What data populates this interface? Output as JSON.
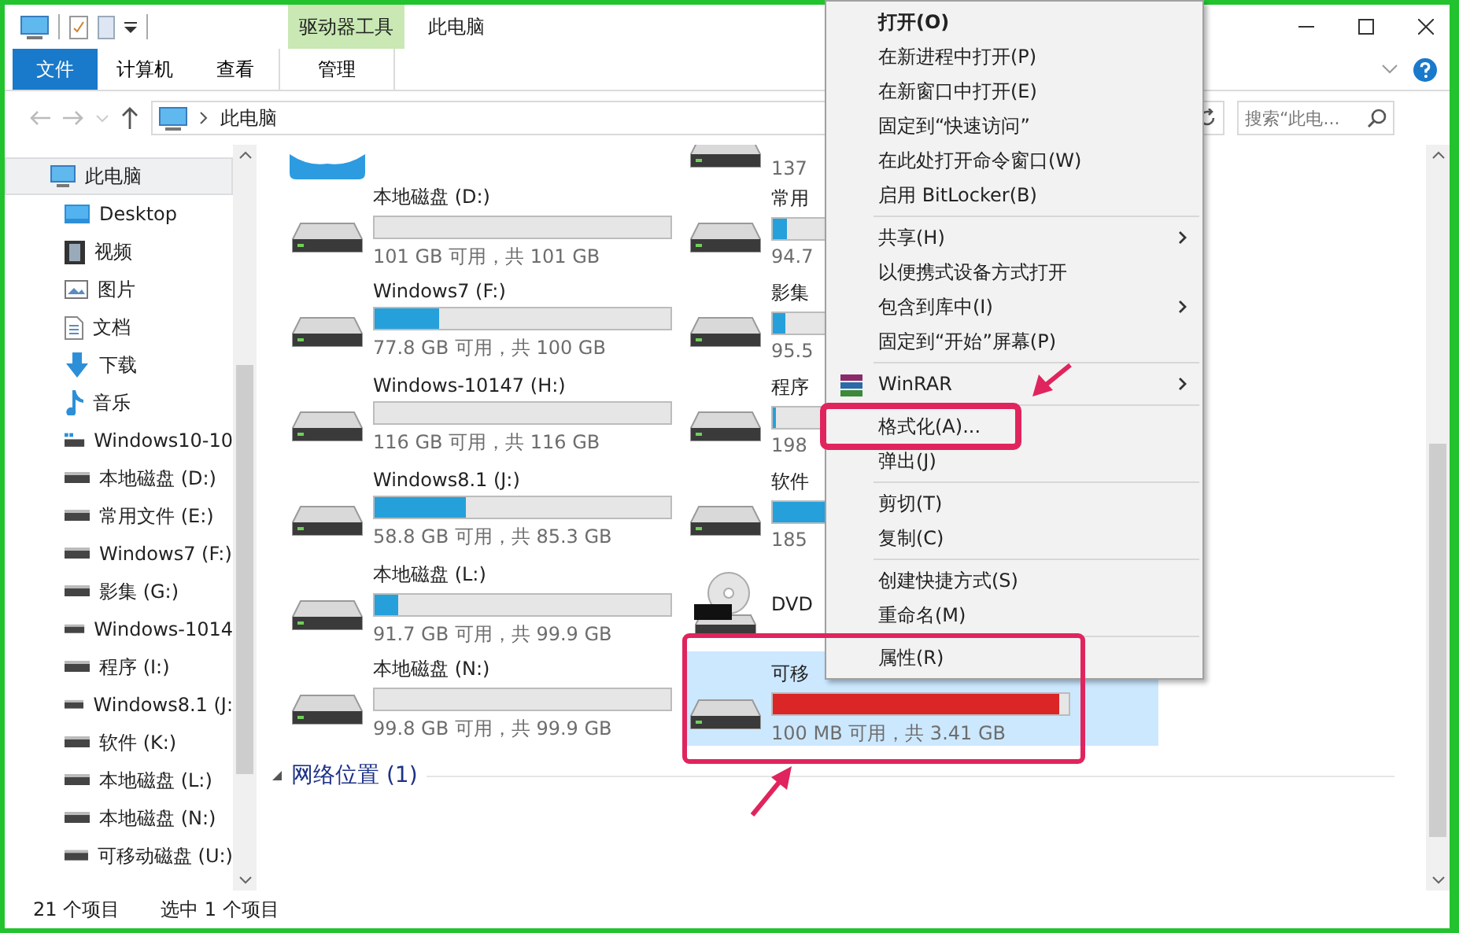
{
  "window": {
    "title": "此电脑",
    "context_group": "驱动器工具"
  },
  "ribbon_tabs": [
    {
      "label": "文件",
      "kind": "file"
    },
    {
      "label": "计算机",
      "kind": "tab"
    },
    {
      "label": "查看",
      "kind": "tab"
    },
    {
      "label": "管理",
      "kind": "context"
    }
  ],
  "address": {
    "path": "此电脑"
  },
  "search": {
    "placeholder": "搜索“此电..."
  },
  "sidebar": {
    "items": [
      {
        "label": "此电脑",
        "selected": true,
        "children": [
          {
            "label": "Desktop",
            "selected": false
          },
          {
            "label": "视频",
            "selected": false
          },
          {
            "label": "图片",
            "selected": false
          },
          {
            "label": "文档",
            "selected": false
          },
          {
            "label": "下载",
            "selected": false
          },
          {
            "label": "音乐",
            "selected": false
          },
          {
            "label": "Windows10-10",
            "selected": false
          },
          {
            "label": "本地磁盘 (D:)",
            "selected": false
          },
          {
            "label": "常用文件 (E:)",
            "selected": false
          },
          {
            "label": "Windows7 (F:)",
            "selected": false
          },
          {
            "label": "影集 (G:)",
            "selected": false
          },
          {
            "label": "Windows-1014",
            "selected": false
          },
          {
            "label": "程序 (I:)",
            "selected": false
          },
          {
            "label": "Windows8.1 (J:",
            "selected": false
          },
          {
            "label": "软件 (K:)",
            "selected": false
          },
          {
            "label": "本地磁盘 (L:)",
            "selected": false
          },
          {
            "label": "本地磁盘 (N:)",
            "selected": false
          },
          {
            "label": "可移动磁盘 (U:)",
            "selected": false
          }
        ]
      }
    ]
  },
  "drives": [
    {
      "kind": "app"
    },
    {
      "kind": "cut",
      "free_text": "137"
    },
    {
      "kind": "disk",
      "name": "本地磁盘 (D:)",
      "selected": false,
      "free_text": "101 GB 可用，共 101 GB"
    },
    {
      "kind": "disk",
      "name": "常用",
      "level": 0.05,
      "warning": false,
      "selected": false,
      "free_text": "94.7"
    },
    {
      "kind": "disk",
      "name": "Windows7 (F:)",
      "level": 0.22,
      "warning": false,
      "selected": false,
      "free_text": "77.8 GB 可用，共 100 GB"
    },
    {
      "kind": "disk",
      "name": "影集",
      "level": 0.04,
      "warning": false,
      "selected": false,
      "free_text": "95.5"
    },
    {
      "kind": "disk",
      "name": "Windows-10147 (H:)",
      "selected": false,
      "free_text": "116 GB 可用，共 116 GB"
    },
    {
      "kind": "disk",
      "name": "程序",
      "level": 0.01,
      "warning": false,
      "selected": false,
      "free_text": "198"
    },
    {
      "kind": "disk",
      "name": "Windows8.1 (J:)",
      "level": 0.31,
      "warning": false,
      "selected": false,
      "free_text": "58.8 GB 可用，共 85.3 GB"
    },
    {
      "kind": "disk",
      "name": "软件",
      "level": 0.5,
      "warning": false,
      "selected": false,
      "free_text": "185"
    },
    {
      "kind": "disk",
      "name": "本地磁盘 (L:)",
      "level": 0.08,
      "warning": false,
      "selected": false,
      "free_text": "91.7 GB 可用，共 99.9 GB"
    },
    {
      "kind": "dvd",
      "name": "DVD"
    },
    {
      "kind": "disk",
      "name": "本地磁盘 (N:)",
      "selected": false,
      "free_text": "99.8 GB 可用，共 99.9 GB"
    },
    {
      "kind": "disk",
      "name": "可移",
      "level": 0.97,
      "warning": true,
      "selected": true,
      "free_text": "100 MB 可用，共 3.41 GB"
    }
  ],
  "network": {
    "label": "网络位置 (1)"
  },
  "status_bar": [
    "21 个项目",
    "选中 1 个项目"
  ],
  "context_menu": [
    {
      "kind": "item",
      "label": "打开(O)",
      "default": true,
      "submenu": false
    },
    {
      "kind": "item",
      "label": "在新进程中打开(P)",
      "default": false,
      "submenu": false
    },
    {
      "kind": "item",
      "label": "在新窗口中打开(E)",
      "default": false,
      "submenu": false
    },
    {
      "kind": "item",
      "label": "固定到“快速访问”",
      "default": false,
      "submenu": false
    },
    {
      "kind": "item",
      "label": "在此处打开命令窗口(W)",
      "default": false,
      "submenu": false
    },
    {
      "kind": "item",
      "label": "启用 BitLocker(B)",
      "default": false,
      "submenu": false
    },
    {
      "kind": "separator"
    },
    {
      "kind": "item",
      "label": "共享(H)",
      "default": false,
      "submenu": true
    },
    {
      "kind": "item",
      "label": "以便携式设备方式打开",
      "default": false,
      "submenu": false
    },
    {
      "kind": "item",
      "label": "包含到库中(I)",
      "default": false,
      "submenu": true
    },
    {
      "kind": "item",
      "label": "固定到“开始”屏幕(P)",
      "default": false,
      "submenu": false
    },
    {
      "kind": "separator"
    },
    {
      "kind": "app",
      "label": "WinRAR",
      "default": false,
      "submenu": true
    },
    {
      "kind": "separator"
    },
    {
      "kind": "item",
      "label": "格式化(A)...",
      "default": false,
      "submenu": false
    },
    {
      "kind": "item",
      "label": "弹出(J)",
      "default": false,
      "submenu": false
    },
    {
      "kind": "separator"
    },
    {
      "kind": "item",
      "label": "剪切(T)",
      "default": false,
      "submenu": false
    },
    {
      "kind": "item",
      "label": "复制(C)",
      "default": false,
      "submenu": false
    },
    {
      "kind": "separator"
    },
    {
      "kind": "item",
      "label": "创建快捷方式(S)",
      "default": false,
      "submenu": false
    },
    {
      "kind": "item",
      "label": "重命名(M)",
      "default": false,
      "submenu": false
    },
    {
      "kind": "separator"
    },
    {
      "kind": "item",
      "label": "属性(R)",
      "default": false,
      "submenu": false
    }
  ]
}
